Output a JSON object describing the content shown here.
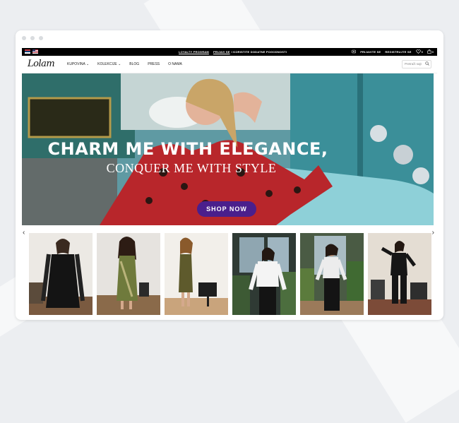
{
  "topbar": {
    "flag_1": "serbian-flag",
    "flag_2": "usa-flag",
    "loyalty": "LOYALTY PROGRAM",
    "promo_link": "PRIJAVI SE",
    "promo_text": "I KORISTITE DODATNE POGODNOSTI",
    "login": "PRIJAVITE SE",
    "register": "REGISTRUJTE SE",
    "wishlist_count": "0",
    "cart_count": "0"
  },
  "nav": {
    "logo": "Lolam",
    "items": [
      "KUPOVINA",
      "KOLEKCIJE",
      "BLOG",
      "PRESS",
      "O NAMA"
    ],
    "search_placeholder": "Pretraži sajt"
  },
  "hero": {
    "headline": "CHARM ME WITH ELEGANCE,",
    "subheadline": "CONQUER ME WITH STYLE",
    "cta": "SHOP NOW"
  },
  "carousel": {
    "prev_icon": "chevron-left-icon",
    "next_icon": "chevron-right-icon",
    "count": 6
  },
  "colors": {
    "cta_purple": "#4a1f8c",
    "topbar_black": "#000000",
    "dress_red": "#b8262b"
  }
}
